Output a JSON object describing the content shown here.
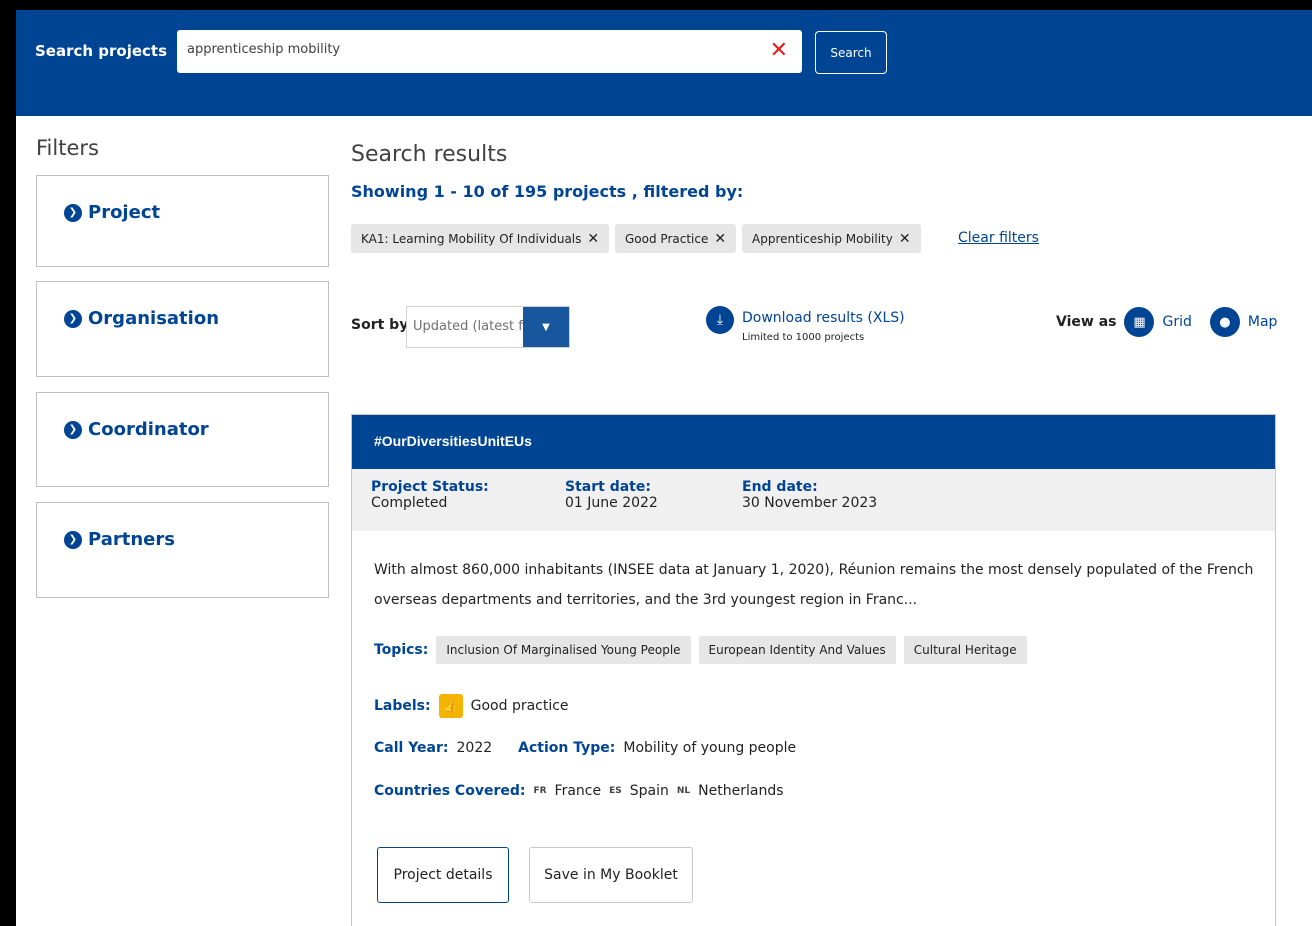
{
  "header": {
    "search_label": "Search projects",
    "search_value": "apprenticeship mobility",
    "clear_icon": "✕",
    "search_button": "Search"
  },
  "filters": {
    "title": "Filters",
    "items": [
      {
        "label": "Project"
      },
      {
        "label": "Organisation"
      },
      {
        "label": "Coordinator"
      },
      {
        "label": "Partners"
      }
    ]
  },
  "results": {
    "title": "Search results",
    "showing": "Showing 1 - 10 of 195 projects , filtered by:",
    "chips": [
      {
        "label": "KA1: Learning Mobility Of Individuals"
      },
      {
        "label": "Good Practice"
      },
      {
        "label": "Apprenticeship Mobility"
      }
    ],
    "clear_filters": "Clear filters",
    "sort_label": "Sort by",
    "sort_value": "Updated (latest first)",
    "download_label": "Download results (XLS)",
    "download_note": "Limited to 1000 projects",
    "view_as": "View as",
    "view_grid": "Grid",
    "view_map": "Map"
  },
  "card": {
    "title": "#OurDiversitiesUnitEUs",
    "status_label": "Project Status:",
    "status_value": "Completed",
    "start_label": "Start date:",
    "start_value": "01 June 2022",
    "end_label": "End date:",
    "end_value": "30 November 2023",
    "description": "With almost 860,000 inhabitants (INSEE data at January 1, 2020), Réunion remains the most densely populated of the French overseas departments and territories, and the 3rd youngest region in Franc...",
    "topics_label": "Topics:",
    "topics": [
      "Inclusion Of Marginalised Young People",
      "European Identity And Values",
      "Cultural Heritage"
    ],
    "labels_label": "Labels:",
    "labels_value": "Good practice",
    "call_year_label": "Call Year:",
    "call_year_value": "2022",
    "action_type_label": "Action Type:",
    "action_type_value": "Mobility of young people",
    "countries_label": "Countries Covered:",
    "countries": [
      {
        "code": "FR",
        "name": "France"
      },
      {
        "code": "ES",
        "name": "Spain"
      },
      {
        "code": "NL",
        "name": "Netherlands"
      }
    ],
    "details_button": "Project details",
    "booklet_button": "Save in My Booklet"
  },
  "colors": {
    "brand_blue": "#004494",
    "clear_red": "#e02020",
    "label_yellow": "#f4b400"
  }
}
